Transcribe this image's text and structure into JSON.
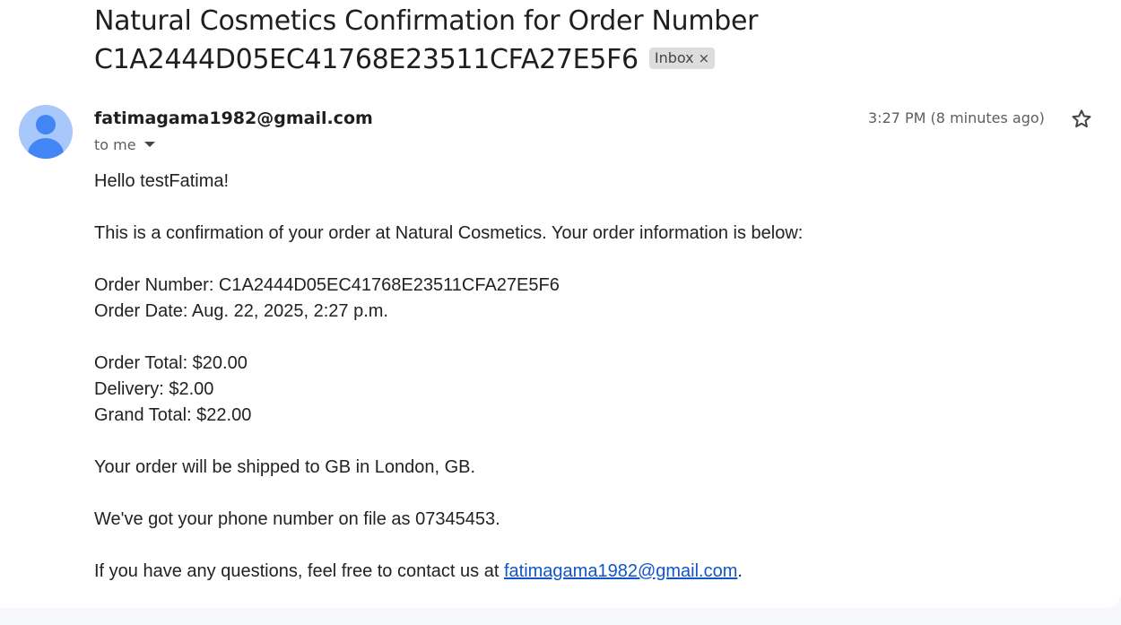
{
  "email": {
    "subject": "Natural Cosmetics Confirmation for Order Number C1A2444D05EC41768E23511CFA27E5F6",
    "label_chip": "Inbox",
    "label_chip_close": "×",
    "sender": "fatimagama1982@gmail.com",
    "recipient": "to me",
    "timestamp": "3:27 PM (8 minutes ago)",
    "icons": {
      "avatar": "default-person-avatar",
      "recipient_toggle": "caret-down-icon",
      "star": "star-outline-icon"
    },
    "colors": {
      "avatar_bg": "#a8c7fa",
      "avatar_fg": "#4285f4",
      "link": "#1155cc"
    }
  },
  "body": {
    "greeting": "Hello testFatima!",
    "intro": "This is a confirmation of your order at Natural Cosmetics. Your order information is below:",
    "order_number": "Order Number: C1A2444D05EC41768E23511CFA27E5F6",
    "order_date": "Order Date: Aug. 22, 2025, 2:27 p.m.",
    "order_total": "Order Total: $20.00",
    "delivery": "Delivery: $2.00",
    "grand_total": "Grand Total: $22.00",
    "shipping": "Your order will be shipped to GB in London, GB.",
    "phone": "We've got your phone number on file as 07345453.",
    "contact_prefix": "If you have any questions, feel free to contact us at ",
    "contact_email": "fatimagama1982@gmail.com",
    "contact_suffix": "."
  }
}
